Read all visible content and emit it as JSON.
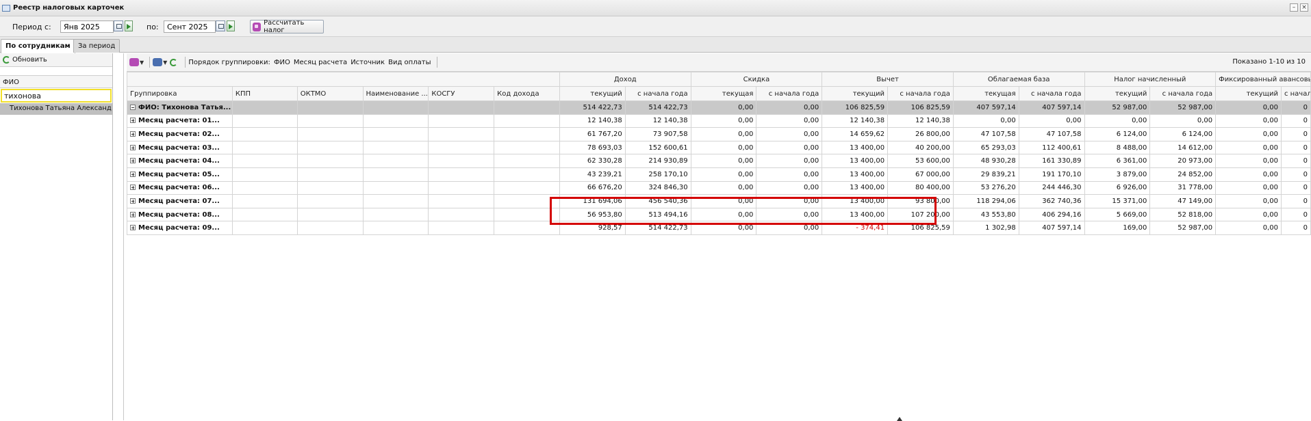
{
  "window": {
    "title": "Реестр налоговых карточек"
  },
  "period": {
    "from_label": "Период с:",
    "from_value": "Янв 2025",
    "to_label": "по:",
    "to_value": "Сент 2025",
    "calc_button": "Рассчитать налог"
  },
  "tabs": [
    {
      "label": "По сотрудникам",
      "active": true
    },
    {
      "label": "За период",
      "active": false
    }
  ],
  "left_panel": {
    "refresh_label": "Обновить",
    "column_header": "ФИО",
    "filter_value": "тихонова",
    "rows": [
      "Тихонова Татьяна Александ..."
    ]
  },
  "toolbar": {
    "grouping_label": "Порядок группировки:",
    "grouping_items": [
      "ФИО",
      "Месяц расчета",
      "Источник",
      "Вид оплаты"
    ],
    "shown": "Показано 1-10 из 10"
  },
  "grid": {
    "group_headers": [
      "Доход",
      "Скидка",
      "Вычет",
      "Облагаемая база",
      "Налог начисленный",
      "Фиксированный авансовый плате"
    ],
    "columns": [
      "Группировка",
      "КПП",
      "ОКТМО",
      "Наименование ...",
      "КОСГУ",
      "Код дохода",
      "текущий",
      "с начала года",
      "текущая",
      "с начала года",
      "текущий",
      "с начала года",
      "текущая",
      "с начала года",
      "текущий",
      "с начала года",
      "текущий",
      "с начала года"
    ],
    "rows": [
      {
        "label": "ФИО: Тихонова Татья...",
        "total": true,
        "values": [
          "514 422,73",
          "514 422,73",
          "0,00",
          "0,00",
          "106 825,59",
          "106 825,59",
          "407 597,14",
          "407 597,14",
          "52 987,00",
          "52 987,00",
          "0,00",
          "0"
        ]
      },
      {
        "label": "Месяц расчета: 01...",
        "values": [
          "12 140,38",
          "12 140,38",
          "0,00",
          "0,00",
          "12 140,38",
          "12 140,38",
          "0,00",
          "0,00",
          "0,00",
          "0,00",
          "0,00",
          "0"
        ]
      },
      {
        "label": "Месяц расчета: 02...",
        "values": [
          "61 767,20",
          "73 907,58",
          "0,00",
          "0,00",
          "14 659,62",
          "26 800,00",
          "47 107,58",
          "47 107,58",
          "6 124,00",
          "6 124,00",
          "0,00",
          "0"
        ]
      },
      {
        "label": "Месяц расчета: 03...",
        "values": [
          "78 693,03",
          "152 600,61",
          "0,00",
          "0,00",
          "13 400,00",
          "40 200,00",
          "65 293,03",
          "112 400,61",
          "8 488,00",
          "14 612,00",
          "0,00",
          "0"
        ]
      },
      {
        "label": "Месяц расчета: 04...",
        "values": [
          "62 330,28",
          "214 930,89",
          "0,00",
          "0,00",
          "13 400,00",
          "53 600,00",
          "48 930,28",
          "161 330,89",
          "6 361,00",
          "20 973,00",
          "0,00",
          "0"
        ]
      },
      {
        "label": "Месяц расчета: 05...",
        "values": [
          "43 239,21",
          "258 170,10",
          "0,00",
          "0,00",
          "13 400,00",
          "67 000,00",
          "29 839,21",
          "191 170,10",
          "3 879,00",
          "24 852,00",
          "0,00",
          "0"
        ]
      },
      {
        "label": "Месяц расчета: 06...",
        "values": [
          "66 676,20",
          "324 846,30",
          "0,00",
          "0,00",
          "13 400,00",
          "80 400,00",
          "53 276,20",
          "244 446,30",
          "6 926,00",
          "31 778,00",
          "0,00",
          "0"
        ]
      },
      {
        "label": "Месяц расчета: 07...",
        "values": [
          "131 694,06",
          "456 540,36",
          "0,00",
          "0,00",
          "13 400,00",
          "93 800,00",
          "118 294,06",
          "362 740,36",
          "15 371,00",
          "47 149,00",
          "0,00",
          "0"
        ]
      },
      {
        "label": "Месяц расчета: 08...",
        "values": [
          "56 953,80",
          "513 494,16",
          "0,00",
          "0,00",
          "13 400,00",
          "107 200,00",
          "43 553,80",
          "406 294,16",
          "5 669,00",
          "52 818,00",
          "0,00",
          "0"
        ]
      },
      {
        "label": "Месяц расчета: 09...",
        "values": [
          "928,57",
          "514 422,73",
          "0,00",
          "0,00",
          "- 374,41",
          "106 825,59",
          "1 302,98",
          "407 597,14",
          "169,00",
          "52 987,00",
          "0,00",
          "0"
        ],
        "negative_index": 4
      }
    ]
  },
  "colors": {
    "highlight_border": "#d40000",
    "filter_border": "#f2e02a",
    "negative": "#d00000"
  }
}
